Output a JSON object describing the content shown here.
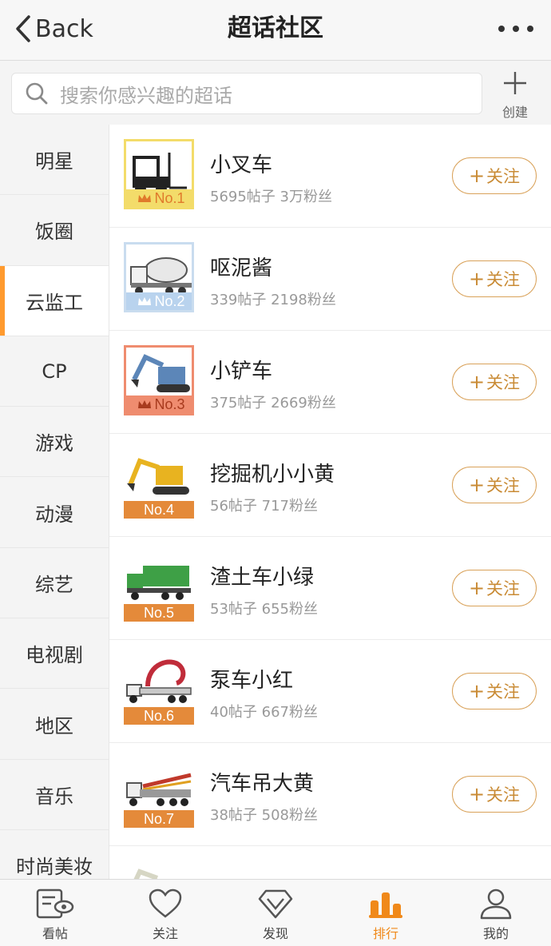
{
  "header": {
    "back_label": "Back",
    "title": "超话社区"
  },
  "search": {
    "placeholder": "搜索你感兴趣的超话",
    "create_label": "创建"
  },
  "categories": [
    {
      "label": "明星"
    },
    {
      "label": "饭圈"
    },
    {
      "label": "云监工"
    },
    {
      "label": "CP"
    },
    {
      "label": "游戏"
    },
    {
      "label": "动漫"
    },
    {
      "label": "综艺"
    },
    {
      "label": "电视剧"
    },
    {
      "label": "地区"
    },
    {
      "label": "音乐"
    },
    {
      "label": "时尚美妆"
    }
  ],
  "active_category": "云监工",
  "follow_label": "关注",
  "topics": [
    {
      "rank": "No.1",
      "name": "小叉车",
      "stats": "5695帖子 3万粉丝",
      "vehicle": "forklift",
      "band_color": "#f3dc6a"
    },
    {
      "rank": "No.2",
      "name": "呕泥酱",
      "stats": "339帖子 2198粉丝",
      "vehicle": "cement-mixer",
      "band_color": "#b9d3ee"
    },
    {
      "rank": "No.3",
      "name": "小铲车",
      "stats": "375帖子 2669粉丝",
      "vehicle": "excavator",
      "band_color": "#ef8c6f"
    },
    {
      "rank": "No.4",
      "name": "挖掘机小小黄",
      "stats": "56帖子 717粉丝",
      "vehicle": "yellow-excavator",
      "band_color": "#e48a3a"
    },
    {
      "rank": "No.5",
      "name": "渣土车小绿",
      "stats": "53帖子 655粉丝",
      "vehicle": "dump-truck",
      "band_color": "#e48a3a"
    },
    {
      "rank": "No.6",
      "name": "泵车小红",
      "stats": "40帖子 667粉丝",
      "vehicle": "pump-truck",
      "band_color": "#e48a3a"
    },
    {
      "rank": "No.7",
      "name": "汽车吊大黄",
      "stats": "38帖子 508粉丝",
      "vehicle": "crane-truck",
      "band_color": "#e48a3a"
    }
  ],
  "tabs": [
    {
      "label": "看帖",
      "icon": "posts-icon"
    },
    {
      "label": "关注",
      "icon": "heart-icon"
    },
    {
      "label": "发现",
      "icon": "discover-diamond-icon"
    },
    {
      "label": "排行",
      "icon": "ranking-bars-icon"
    },
    {
      "label": "我的",
      "icon": "profile-icon"
    }
  ],
  "colors": {
    "accent": "#f0891a",
    "follow_border": "#d9a25a",
    "follow_text": "#c98b35"
  }
}
